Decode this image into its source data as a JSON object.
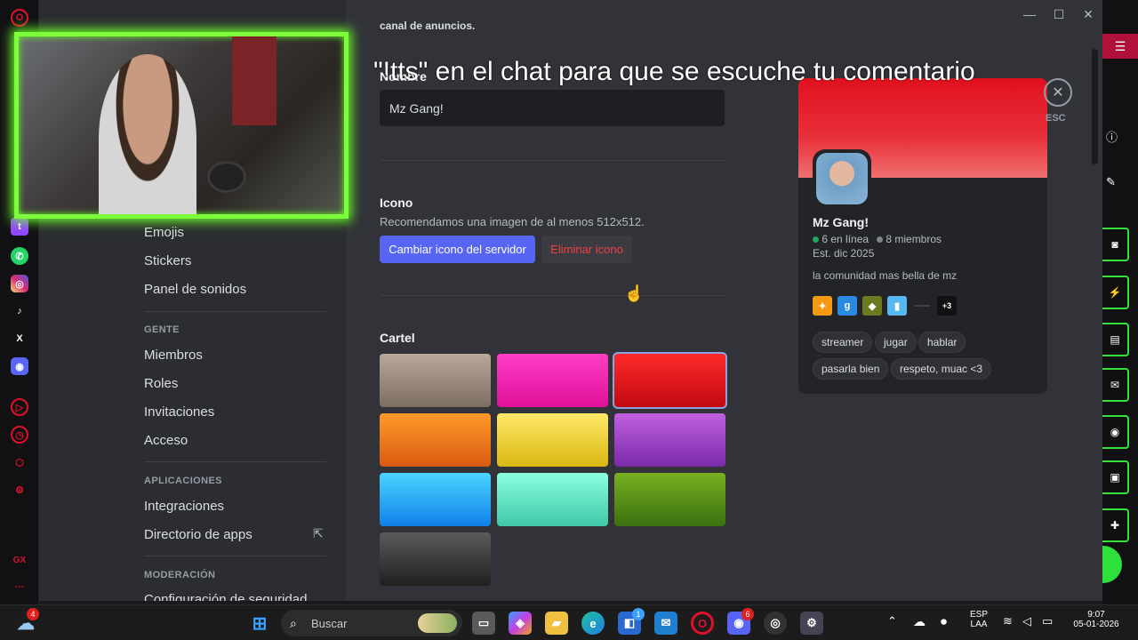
{
  "opera": {
    "logo": "O",
    "gx_label": "GX",
    "more": "···"
  },
  "window_controls": {
    "minimize": "—",
    "maximize": "☐",
    "close": "✕"
  },
  "sidebar": {
    "items_top": [
      {
        "label": "Emojis"
      },
      {
        "label": "Stickers"
      },
      {
        "label": "Panel de sonidos"
      }
    ],
    "gente_heading": "GENTE",
    "gente_items": [
      {
        "label": "Miembros"
      },
      {
        "label": "Roles"
      },
      {
        "label": "Invitaciones"
      },
      {
        "label": "Acceso"
      }
    ],
    "apps_heading": "APLICACIONES",
    "apps_items": [
      {
        "label": "Integraciones"
      },
      {
        "label": "Directorio de apps"
      }
    ],
    "moderation_heading": "MODERACIÓN",
    "moderation_items": [
      {
        "label": "Configuración de seguridad"
      }
    ]
  },
  "main": {
    "top_fragment": "canal de anuncios.",
    "name_label": "Nombre",
    "name_value": "Mz Gang!",
    "icon_label": "Icono",
    "icon_hint": "Recomendamos una imagen de al menos 512x512.",
    "change_icon_button": "Cambiar icono del servidor",
    "remove_icon_button": "Eliminar icono",
    "banner_label": "Cartel",
    "banner_swatches": [
      {
        "name": "taupe",
        "from": "#b8a89a",
        "to": "#7d6e62"
      },
      {
        "name": "magenta",
        "from": "#ff3ec6",
        "to": "#e0109a"
      },
      {
        "name": "red",
        "from": "#ff2a2a",
        "to": "#c00a10",
        "selected": true
      },
      {
        "name": "orange",
        "from": "#ff9a2a",
        "to": "#d85a10"
      },
      {
        "name": "yellow",
        "from": "#ffe86a",
        "to": "#d8b810"
      },
      {
        "name": "purple",
        "from": "#c060e0",
        "to": "#7a2aa8"
      },
      {
        "name": "blue",
        "from": "#4ad4ff",
        "to": "#1080e8"
      },
      {
        "name": "teal",
        "from": "#8affe0",
        "to": "#40c8a8"
      },
      {
        "name": "green",
        "from": "#7ab020",
        "to": "#3a7010"
      },
      {
        "name": "charcoal",
        "from": "#5a5a5a",
        "to": "#202020"
      }
    ]
  },
  "preview_card": {
    "server_name": "Mz Gang!",
    "online": "6 en línea",
    "members": "8 miembros",
    "established": "Est. dic 2025",
    "description": "la comunidad mas bella de mz",
    "games_more": "+3",
    "tags": [
      "streamer",
      "jugar",
      "hablar",
      "pasarla bien",
      "respeto, muac <3"
    ]
  },
  "esc": {
    "icon": "✕",
    "label": "ESC"
  },
  "overlay_caption": "\"!tts\" en el chat para que se escuche tu comentario",
  "taskbar": {
    "search_placeholder": "Buscar",
    "weather_badge": "4",
    "store_badge": "1",
    "discord_badge": "6",
    "lang_top": "ESP",
    "lang_bottom": "LAA",
    "time": "9:07",
    "date": "05-01-2026"
  },
  "colors": {
    "accent": "#5865f2",
    "danger_text": "#f23f43",
    "online": "#23a55a",
    "overlay_border": "#7cff3a"
  }
}
